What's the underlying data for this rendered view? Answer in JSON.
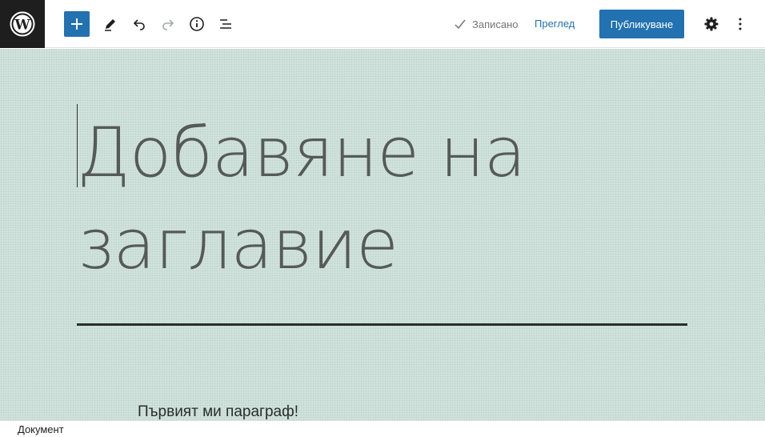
{
  "toolbar": {
    "add_block_icon": "plus-icon",
    "tools_icon": "pencil-icon",
    "undo_icon": "undo-icon",
    "redo_icon": "redo-icon",
    "details_icon": "info-icon",
    "outline_icon": "list-view-icon",
    "saved_label": "Записано",
    "preview_label": "Преглед",
    "publish_label": "Публикуване",
    "settings_icon": "gear-icon",
    "options_icon": "more-vertical-icon",
    "accent_color": "#2271b1"
  },
  "editor": {
    "title": "Добавяне на заглавие",
    "paragraph": "Първият ми параграф!",
    "background_color": "#cfe1db"
  },
  "statusbar": {
    "breadcrumb": "Документ"
  }
}
